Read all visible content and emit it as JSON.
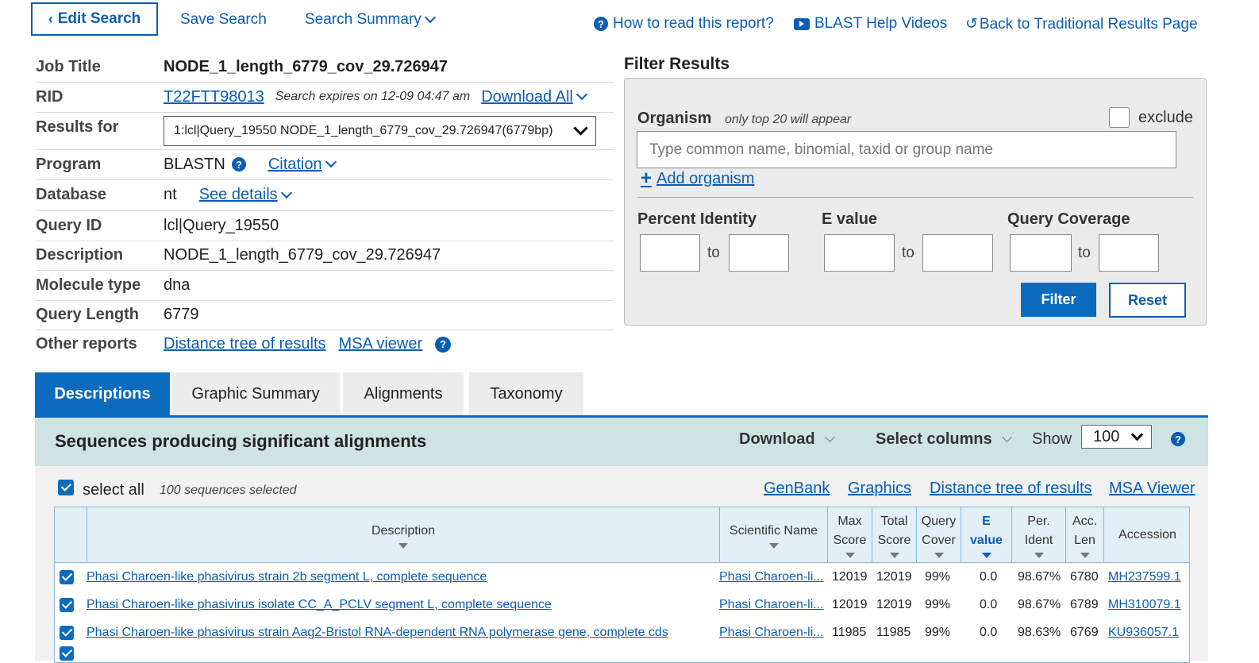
{
  "topbar": {
    "edit_search": "Edit Search",
    "save_search": "Save Search",
    "search_summary": "Search Summary",
    "how_to_read": "How to read this report?",
    "help_videos": "BLAST Help Videos",
    "back_traditional": "Back to Traditional Results Page"
  },
  "job": {
    "labels": {
      "job_title": "Job Title",
      "rid": "RID",
      "results_for": "Results for",
      "program": "Program",
      "database": "Database",
      "query_id": "Query ID",
      "description": "Description",
      "molecule_type": "Molecule type",
      "query_length": "Query Length",
      "other_reports": "Other reports"
    },
    "job_title": "NODE_1_length_6779_cov_29.726947",
    "rid": "T22FTT98013",
    "expires": "Search expires on 12-09 04:47 am",
    "download_all": "Download All",
    "results_for": "1:lcl|Query_19550 NODE_1_length_6779_cov_29.726947(6779bp)",
    "program": "BLASTN",
    "citation": "Citation",
    "database": "nt",
    "see_details": "See details",
    "query_id": "lcl|Query_19550",
    "description": "NODE_1_length_6779_cov_29.726947",
    "molecule_type": "dna",
    "query_length": "6779",
    "distance_tree": "Distance tree of results",
    "msa_viewer": "MSA viewer"
  },
  "filter": {
    "title": "Filter Results",
    "organism_label": "Organism",
    "organism_hint": "only top 20 will appear",
    "exclude": "exclude",
    "organism_placeholder": "Type common  name, binomial, taxid or group  name",
    "add_organism": "Add organism",
    "percent_identity": "Percent Identity",
    "e_value": "E value",
    "query_coverage": "Query Coverage",
    "to": "to",
    "filter_btn": "Filter",
    "reset_btn": "Reset"
  },
  "tabs": [
    "Descriptions",
    "Graphic Summary",
    "Alignments",
    "Taxonomy"
  ],
  "results": {
    "heading": "Sequences producing significant alignments",
    "download": "Download",
    "select_columns": "Select columns",
    "show": "Show",
    "show_value": "100",
    "select_all": "select all",
    "selected_count": "100 sequences selected",
    "links": [
      "GenBank",
      "Graphics",
      "Distance tree of results",
      "MSA Viewer"
    ],
    "columns": {
      "description": "Description",
      "scientific_name": "Scientific Name",
      "max_score": [
        "Max",
        "Score"
      ],
      "total_score": [
        "Total",
        "Score"
      ],
      "query_cover": [
        "Query",
        "Cover"
      ],
      "e_value": [
        "E",
        "value"
      ],
      "per_ident": [
        "Per.",
        "Ident"
      ],
      "acc_len": [
        "Acc.",
        "Len"
      ],
      "accession": "Accession"
    },
    "rows": [
      {
        "description": "Phasi Charoen-like phasivirus strain 2b segment L, complete sequence",
        "sci": "Phasi Charoen-li...",
        "max": "12019",
        "total": "12019",
        "cover": "99%",
        "evalue": "0.0",
        "ident": "98.67%",
        "len": "6780",
        "acc": "MH237599.1"
      },
      {
        "description": "Phasi Charoen-like phasivirus isolate CC_A_PCLV segment L, complete sequence",
        "sci": "Phasi Charoen-li...",
        "max": "12019",
        "total": "12019",
        "cover": "99%",
        "evalue": "0.0",
        "ident": "98.67%",
        "len": "6789",
        "acc": "MH310079.1"
      },
      {
        "description": "Phasi Charoen-like phasivirus strain Aag2-Bristol RNA-dependent RNA polymerase gene, complete cds",
        "sci": "Phasi Charoen-li...",
        "max": "11985",
        "total": "11985",
        "cover": "99%",
        "evalue": "0.0",
        "ident": "98.63%",
        "len": "6769",
        "acc": "KU936057.1"
      }
    ]
  }
}
